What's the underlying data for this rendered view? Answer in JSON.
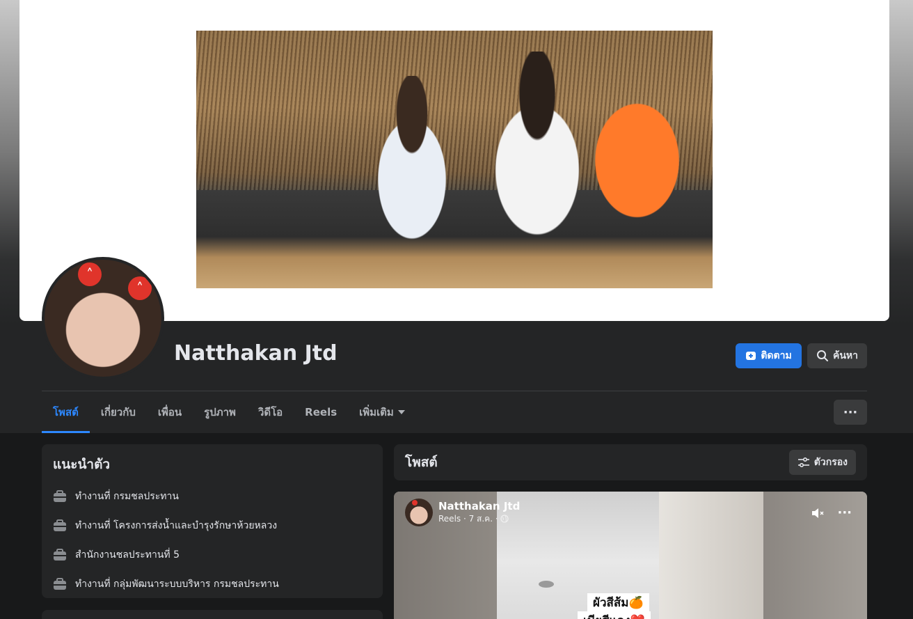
{
  "profile": {
    "name": "Natthakan Jtd",
    "follow_label": "ติดตาม",
    "search_label": "ค้นหา"
  },
  "tabs": [
    {
      "label": "โพสต์"
    },
    {
      "label": "เกี่ยวกับ"
    },
    {
      "label": "เพื่อน"
    },
    {
      "label": "รูปภาพ"
    },
    {
      "label": "วิดีโอ"
    },
    {
      "label": "Reels"
    },
    {
      "label": "เพิ่มเติม"
    }
  ],
  "intro": {
    "title": "แนะนำตัว",
    "items": [
      {
        "label": "ทำงานที่ กรมชลประทาน"
      },
      {
        "label": "ทำงานที่ โครงการส่งน้ำและบำรุงรักษาห้วยหลวง"
      },
      {
        "label": "สำนักงานชลประทานที่ 5"
      },
      {
        "label": "ทำงานที่ กลุ่มพัฒนาระบบบริหาร กรมชลประทาน"
      }
    ]
  },
  "posts": {
    "title": "โพสต์",
    "filter_label": "ตัวกรอง"
  },
  "reel_post": {
    "author": "Natthakan Jtd",
    "meta": "Reels · 7 ส.ค. ·",
    "caption_line1": "ผัวสีส้ม🍊",
    "caption_line2": "เมียสีแดง❤️"
  },
  "colors": {
    "accent": "#2374e1",
    "active_tab": "#2d88ff",
    "card_bg": "#242526",
    "page_bg": "#18191a"
  }
}
